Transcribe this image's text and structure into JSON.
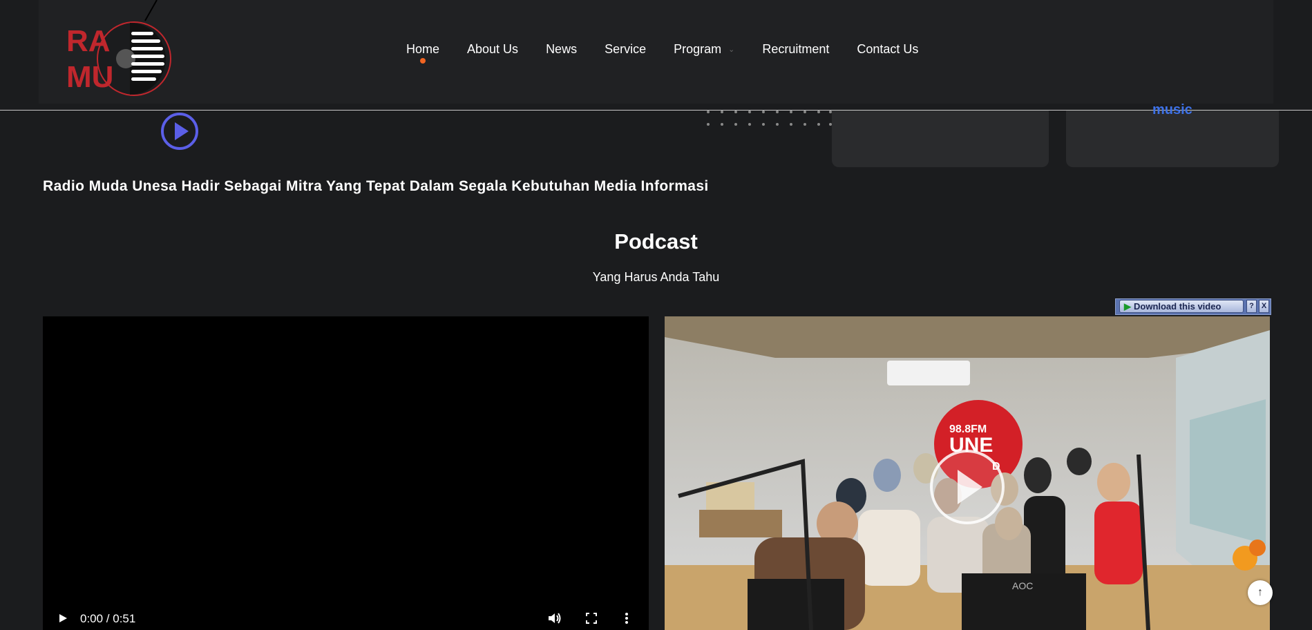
{
  "header": {
    "logo_text_line1": "RA",
    "logo_text_line2": "MU",
    "nav": [
      {
        "label": "Home",
        "active": true
      },
      {
        "label": "About Us"
      },
      {
        "label": "News"
      },
      {
        "label": "Service"
      },
      {
        "label": "Program",
        "has_dropdown": true
      },
      {
        "label": "Recruitment"
      },
      {
        "label": "Contact Us"
      }
    ]
  },
  "hero": {
    "card2_text": "music",
    "tagline": "Radio Muda Unesa Hadir Sebagai Mitra Yang Tepat Dalam Segala Kebutuhan  Media Informasi"
  },
  "podcast": {
    "title": "Podcast",
    "subtitle": "Yang Harus Anda Tahu"
  },
  "video_player": {
    "time": "0:00 / 0:51"
  },
  "download_bar": {
    "label": "Download this video",
    "help": "?",
    "close": "X"
  },
  "station_sign": {
    "line1": "98.8FM",
    "line2": "UNE",
    "line3": "D",
    "monitor_brand": "AOC"
  },
  "colors": {
    "accent": "#f26522",
    "logo_red": "#c0272d",
    "play_blue": "#5b5fe8",
    "background": "#1b1c1e"
  }
}
